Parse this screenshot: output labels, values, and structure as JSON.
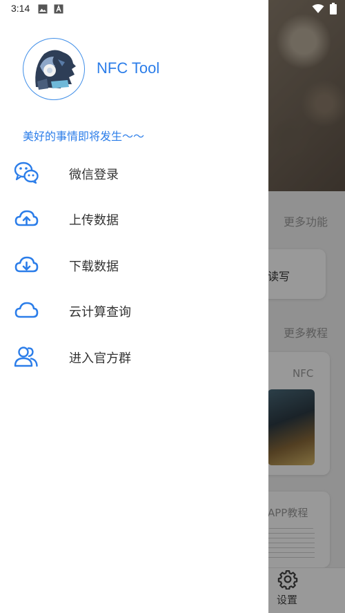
{
  "status_bar": {
    "time": "3:14",
    "icons": [
      "image-notification-icon",
      "a-notification-icon",
      "wifi-icon",
      "battery-icon"
    ]
  },
  "drawer": {
    "app_name": "NFC Tool",
    "tagline": "美好的事情即将发生～～",
    "menu": [
      {
        "label": "微信登录",
        "icon": "wechat-icon"
      },
      {
        "label": "上传数据",
        "icon": "cloud-upload-icon"
      },
      {
        "label": "下载数据",
        "icon": "cloud-download-icon"
      },
      {
        "label": "云计算查询",
        "icon": "cloud-icon"
      },
      {
        "label": "进入官方群",
        "icon": "group-icon"
      }
    ]
  },
  "background": {
    "more_functions": "更多功能",
    "read_write_label": "读写",
    "more_tutorials": "更多教程",
    "card_nfc_label": "NFC",
    "card_app_label": "APP教程",
    "settings_label": "设置"
  },
  "colors": {
    "accent": "#2b7de9",
    "menu_text": "#333333",
    "scrim": "rgba(0,0,0,0.4)"
  }
}
